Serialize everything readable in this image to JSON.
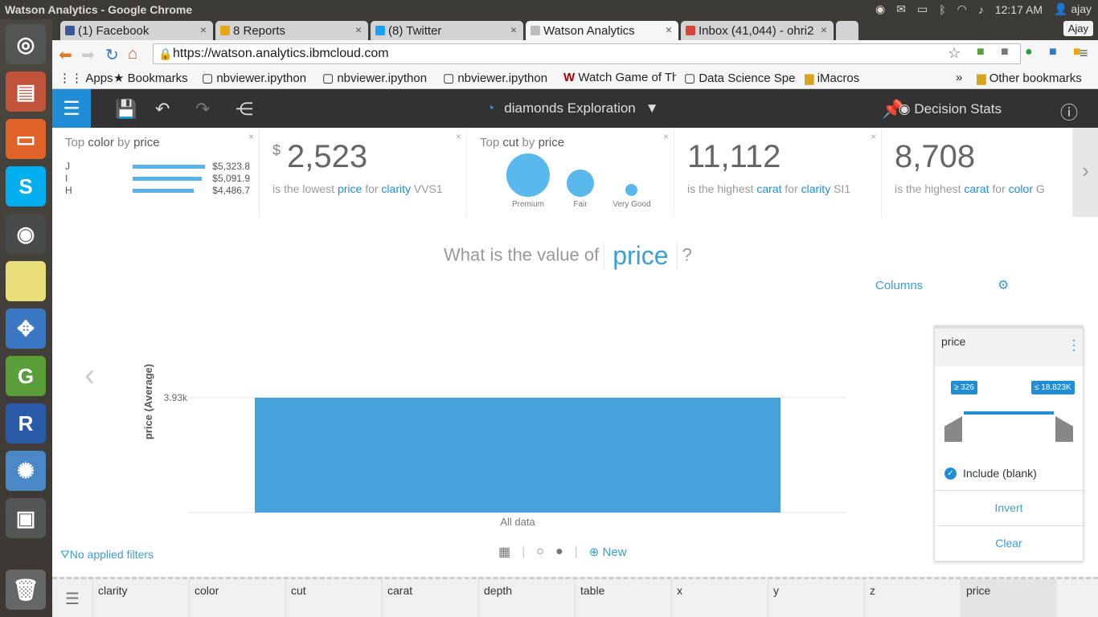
{
  "os": {
    "title": "Watson Analytics - Google Chrome",
    "time": "12:17 AM",
    "user": "ajay"
  },
  "tabs": [
    {
      "label": "(1) Facebook",
      "color": "#3b5998"
    },
    {
      "label": "8 Reports",
      "color": "#e8a317"
    },
    {
      "label": "(8) Twitter",
      "color": "#1da1f2"
    },
    {
      "label": "Watson Analytics",
      "color": "#bbbbbb"
    },
    {
      "label": "Inbox (41,044) - ohri2",
      "color": "#d44638"
    }
  ],
  "profile": "Ajay",
  "url": "https://watson.analytics.ibmcloud.com",
  "bookmarks": [
    "Apps",
    "Bookmarks",
    "nbviewer.ipython",
    "nbviewer.ipython",
    "nbviewer.ipython",
    "Watch Game of Th",
    "Data Science Spe",
    "iMacros",
    "»",
    "Other bookmarks"
  ],
  "appbar": {
    "exploration": "diamonds Exploration",
    "user": "Decision Stats"
  },
  "insights": {
    "c1": {
      "hdr_a": "Top",
      "hdr_b": "color",
      "hdr_c": "by",
      "hdr_d": "price",
      "rows": [
        {
          "label": "J",
          "value": "$5,323.8",
          "frac": 1.0
        },
        {
          "label": "I",
          "value": "$5,091.9",
          "frac": 0.956
        },
        {
          "label": "H",
          "value": "$4,486.7",
          "frac": 0.843
        }
      ]
    },
    "c2": {
      "currency": "$",
      "big": "2,523",
      "pre": "is the lowest",
      "m": "price",
      "for": "for",
      "d": "clarity",
      "v": "VVS1"
    },
    "c3": {
      "hdr_a": "Top",
      "hdr_b": "cut",
      "hdr_c": "by",
      "hdr_d": "price",
      "bubbles": [
        "Premium",
        "Fair",
        "Very Good"
      ]
    },
    "c4": {
      "big": "11,112",
      "pre": "is the highest",
      "m": "carat",
      "for": "for",
      "d": "clarity",
      "v": "SI1"
    },
    "c5": {
      "big": "8,708",
      "pre": "is the highest",
      "m": "carat",
      "for": "for",
      "d": "color",
      "v": "G"
    }
  },
  "question": {
    "pre": "What is the value of",
    "field": "price",
    "post": "?"
  },
  "columns_label": "Columns",
  "chart_data": {
    "type": "bar",
    "categories": [
      "All data"
    ],
    "values": [
      3930
    ],
    "ylabel": "price (Average)",
    "tick_label": "3.93k",
    "ylim": [
      0,
      3930
    ]
  },
  "filters": "No applied filters",
  "new_label": "New",
  "panel": {
    "title": "price",
    "min": "≥ 326",
    "max": "≤ 18.823K",
    "include": "Include (blank)",
    "invert": "Invert",
    "clear": "Clear"
  },
  "column_headers": [
    "clarity",
    "color",
    "cut",
    "carat",
    "depth",
    "table",
    "x",
    "y",
    "z",
    "price"
  ]
}
